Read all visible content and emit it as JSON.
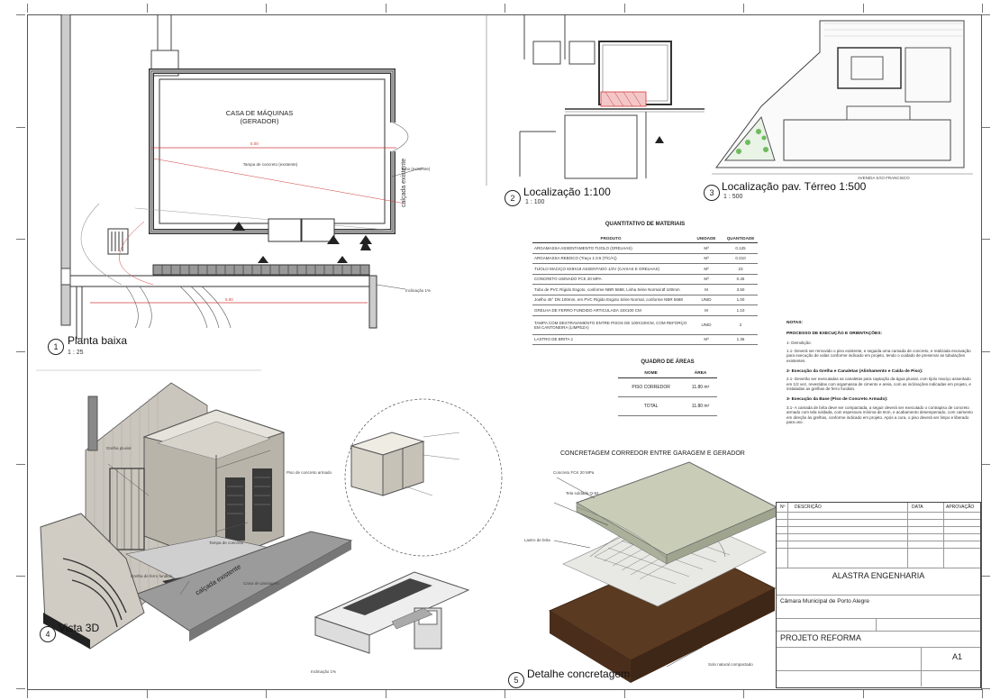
{
  "views": {
    "v1": {
      "num": "1",
      "title": "Planta baixa",
      "scale": "1 : 25"
    },
    "v2": {
      "num": "2",
      "title": "Localização 1:100",
      "scale": "1 : 100"
    },
    "v3": {
      "num": "3",
      "title": "Localização pav. Térreo 1:500",
      "scale": "1 : 500"
    },
    "v4": {
      "num": "4",
      "title": "Vista 3D"
    },
    "v5": {
      "num": "5",
      "title": "Detalhe concretagem"
    }
  },
  "plan": {
    "room_label_1": "CASA DE MÁQUINAS",
    "room_label_2": "(GERADOR)",
    "sidewalk": "calçada existente",
    "dim_1": "5.00",
    "dim_2": "5.00",
    "note_tampa": "Tampa de concreto (existente)",
    "note_inclinacao": "Inclinação 1%",
    "note_tubo": "Tubo (existente)"
  },
  "location": {
    "street": "AVENIDA SÃO FRANCISCO"
  },
  "materials": {
    "title": "QUANTITATIVO DE MATERIAIS",
    "headers": [
      "PRODUTO",
      "UNIDADE",
      "QUANTIDADE"
    ],
    "rows": [
      {
        "produto": "ARGAMASSA ASSENTAMENTO TIJOLO (GRELHAS)",
        "unidade": "M³",
        "quantidade": "0.125"
      },
      {
        "produto": "ARGAMASSA REBOCO (Traço 1:3:6 (T/C/A))",
        "unidade": "M³",
        "quantidade": "0.210"
      },
      {
        "produto": "TIJOLO MACIÇO 6X9X19 ASSENTADO 1/2V (CAIXAS E GRELHAS)",
        "unidade": "M²",
        "quantidade": "23"
      },
      {
        "produto": "CONCRETO USINADO FCK 20 MPA",
        "unidade": "M³",
        "quantidade": "0.45"
      },
      {
        "produto": "Tubo de PVC Rígido Esgoto, conforme NBR 5688, Linha Série Normal Ø 100mm",
        "unidade": "M",
        "quantidade": "3.50"
      },
      {
        "produto": "Joelho 45° DN 100mm, em PVC Rígido Esgoto Série Normal, conforme NBR 5688",
        "unidade": "UNID",
        "quantidade": "1.00"
      },
      {
        "produto": "GRELHA DE FERRO FUNDIDO ARTICULADA 15X100 CM",
        "unidade": "M",
        "quantidade": "1.10"
      },
      {
        "produto": "TAMPA COM DESTRAVAMENTO ENTRE PISOS DE 100X100CM, COM REFORÇO EM CANTONEIRA (LIMPEZA)",
        "unidade": "UNID",
        "quantidade": "2"
      },
      {
        "produto": "LASTRO DE BRITA 1",
        "unidade": "M³",
        "quantidade": "1.36"
      }
    ]
  },
  "areas": {
    "title": "QUADRO DE ÁREAS",
    "headers": [
      "NOME",
      "ÁREA"
    ],
    "rows": [
      {
        "nome": "PISO CORREDOR",
        "area": "11.80 m²"
      }
    ],
    "total_label": "TOTAL",
    "total_value": "11.80 m²"
  },
  "notes": {
    "title": "NOTAS:",
    "subtitle": "PROCESSO DE EXECUÇÃO E ORIENTAÇÕES:",
    "s1": "1- Demolição:",
    "s1_text": "1.1- Deverá ser removido o piso existente, e seguida uma camada de concreto, e realizada escavação para execução de valas conforme indicado em projeto, tendo o cuidado de preservar as tubulações existentes.",
    "s2": "2- Execução da Grelha e Canaletas (Alinhamento e Caída de Piso):",
    "s2_text": "2.1- Deverão ser executadas as canaletas para captação da água pluvial, com tijolo maciço assentado em 1/2 vez, revestidas com argamassa de cimento e areia, com as inclinações indicadas em projeto, e instaladas as grelhas de ferro fundido.",
    "s3": "3- Execução da Base (Piso de Concreto Armado):",
    "s3_text": "3.1- A camada de brita deve ser compactada, a seguir deverá ser executado o contrapiso de concreto armado com tela soldada, com espessura mínima de 8cm, e acabamento desempenado, com caimento em direção às grelhas, conforme indicado em projeto. Após a cura, o piso deverá ser limpo e liberado para uso."
  },
  "labels_3d": {
    "sidewalk": "calçada existente",
    "label_a": "Grelha pluvial",
    "label_b": "Piso de concreto armado",
    "label_c": "Caixa de passagem",
    "note_grelha": "Grelha de ferro fundido",
    "note_tampa": "Tampa de concreto",
    "note_inclinacao": "Inclinação 1%"
  },
  "detail": {
    "title": "CONCRETAGEM CORREDOR ENTRE GARAGEM E GERADOR",
    "label_a": "Concreto FCK 20 MPa",
    "label_b": "Tela soldada Q-92",
    "label_c": "Lastro de brita",
    "label_d": "Solo natural compactado"
  },
  "title_block": {
    "rev_headers": [
      "Nº",
      "DESCRIÇÃO",
      "DATA",
      "APROVAÇÃO"
    ],
    "company": "ALASTRA ENGENHARIA",
    "client": "Câmara Municipal de Porto Alegre",
    "project": "PROJETO REFORMA",
    "sheet": "A1"
  },
  "colors": {
    "line": "#333333",
    "red_dim": "#d23b3b",
    "soil": "#5b3a22",
    "concrete": "#c9cdb7"
  }
}
